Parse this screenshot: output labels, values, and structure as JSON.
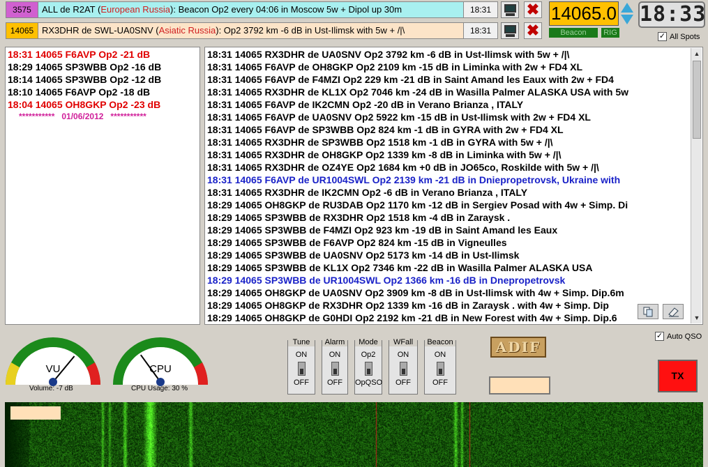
{
  "spot_bars": [
    {
      "freq": "3575",
      "freq_bg": "#d060d0",
      "prefix": "ALL de R2AT (",
      "country": "European Russia",
      "suffix": "): Beacon Op2 every 04:06 in Moscow 5w + Dipol up 30m",
      "bg": "#a8f0f0",
      "time": "18:31"
    },
    {
      "freq": "14065",
      "freq_bg": "#ffc000",
      "prefix": "RX3DHR de SWL-UA0SNV (",
      "country": "Asiatic Russia",
      "suffix": "): Op2 3792 km -6 dB in Ust-Ilimsk with 5w + /|\\",
      "bg": "#fce4c8",
      "time": "18:31"
    }
  ],
  "frequency": "14065.0",
  "beacon_label": "Beacon",
  "rig_label": "RIG",
  "clock": "18:33",
  "all_spots_label": "All Spots",
  "recent_spots": [
    {
      "text": "18:31 14065 F6AVP Op2 -21 dB",
      "color": "red"
    },
    {
      "text": "18:29 14065 SP3WBB Op2 -16 dB",
      "color": "black"
    },
    {
      "text": "18:14 14065 SP3WBB Op2 -12 dB",
      "color": "black"
    },
    {
      "text": "18:10 14065 F6AVP Op2 -18 dB",
      "color": "black"
    },
    {
      "text": "18:04 14065 OH8GKP Op2 -23 dB",
      "color": "red"
    }
  ],
  "date_separator": "***********   01/06/2012   ***********",
  "log": [
    {
      "text": "18:31 14065 RX3DHR de UA0SNV Op2 3792 km -6 dB in Ust-Ilimsk with 5w + /|\\",
      "blue": false
    },
    {
      "text": "18:31 14065 F6AVP de OH8GKP Op2 2109 km -15 dB in Liminka with 2w + FD4 XL",
      "blue": false
    },
    {
      "text": "18:31 14065 F6AVP de F4MZI Op2 229 km -21 dB in Saint Amand les Eaux with 2w + FD4",
      "blue": false
    },
    {
      "text": "18:31 14065 RX3DHR de KL1X Op2 7046 km -24 dB in Wasilla Palmer ALASKA USA with 5w",
      "blue": false
    },
    {
      "text": "18:31 14065 F6AVP de IK2CMN Op2  -20 dB in Verano Brianza , ITALY",
      "blue": false
    },
    {
      "text": "18:31 14065 F6AVP de UA0SNV Op2 5922 km -15 dB in Ust-Ilimsk with 2w + FD4 XL",
      "blue": false
    },
    {
      "text": "18:31 14065 F6AVP de SP3WBB Op2 824 km -1 dB in GYRA with 2w + FD4 XL",
      "blue": false
    },
    {
      "text": "18:31 14065 RX3DHR de SP3WBB Op2 1518 km -1 dB in GYRA with 5w + /|\\",
      "blue": false
    },
    {
      "text": "18:31 14065 RX3DHR de OH8GKP Op2 1339 km -8 dB in Liminka with 5w + /|\\",
      "blue": false
    },
    {
      "text": "18:31 14065 RX3DHR de OZ4YE Op2 1684 km +0 dB in JO65co, Roskilde with 5w + /|\\",
      "blue": false
    },
    {
      "text": "18:31 14065 F6AVP de UR1004SWL Op2 2139 km -21 dB in Dniepropetrovsk, Ukraine with",
      "blue": true
    },
    {
      "text": "18:31 14065 RX3DHR de IK2CMN Op2  -6 dB in Verano Brianza , ITALY",
      "blue": false
    },
    {
      "text": "18:29 14065 OH8GKP de RU3DAB Op2 1170 km -12 dB in Sergiev Posad with 4w + Simp. Di",
      "blue": false
    },
    {
      "text": "18:29 14065 SP3WBB de RX3DHR Op2 1518 km -4 dB in Zaraysk    .",
      "blue": false
    },
    {
      "text": "18:29 14065 SP3WBB de F4MZI Op2 923 km -19 dB in Saint Amand les Eaux",
      "blue": false
    },
    {
      "text": "18:29 14065 SP3WBB de F6AVP Op2 824 km -15 dB in Vigneulles",
      "blue": false
    },
    {
      "text": "18:29 14065 SP3WBB de UA0SNV Op2 5173 km -14 dB in Ust-Ilimsk",
      "blue": false
    },
    {
      "text": "18:29 14065 SP3WBB de KL1X Op2 7346 km -22 dB in Wasilla Palmer ALASKA USA",
      "blue": false
    },
    {
      "text": "18:29 14065 SP3WBB de UR1004SWL Op2 1366 km -16 dB in Dnepropetrovsk",
      "blue": true
    },
    {
      "text": "18:29 14065 OH8GKP de UA0SNV Op2 3909 km -8 dB in Ust-Ilimsk with 4w + Simp. Dip.6m",
      "blue": false
    },
    {
      "text": "18:29 14065 OH8GKP de RX3DHR Op2 1339 km -16 dB in Zaraysk    . with 4w + Simp. Dip",
      "blue": false
    },
    {
      "text": "18:29 14065 OH8GKP de G0HDI Op2 2192 km -21 dB in New Forest with 4w + Simp. Dip.6",
      "blue": false
    }
  ],
  "gauges": {
    "vu": {
      "label": "VU",
      "caption": "Volume: -7 dB",
      "level": 0.72
    },
    "cpu": {
      "label": "CPU",
      "caption": "CPU Usage: 30 %",
      "level": 0.3
    }
  },
  "switches": [
    {
      "title": "Tune",
      "top": "ON",
      "bottom": "OFF"
    },
    {
      "title": "Alarm",
      "top": "ON",
      "bottom": "OFF"
    },
    {
      "title": "Mode",
      "top": "Op2",
      "bottom": "OpQSO"
    },
    {
      "title": "WFall",
      "top": "ON",
      "bottom": "OFF"
    },
    {
      "title": "Beacon",
      "top": "ON",
      "bottom": "OFF"
    }
  ],
  "adif_label": "ADIF",
  "auto_qso_label": "Auto QSO",
  "tx_label": "TX"
}
